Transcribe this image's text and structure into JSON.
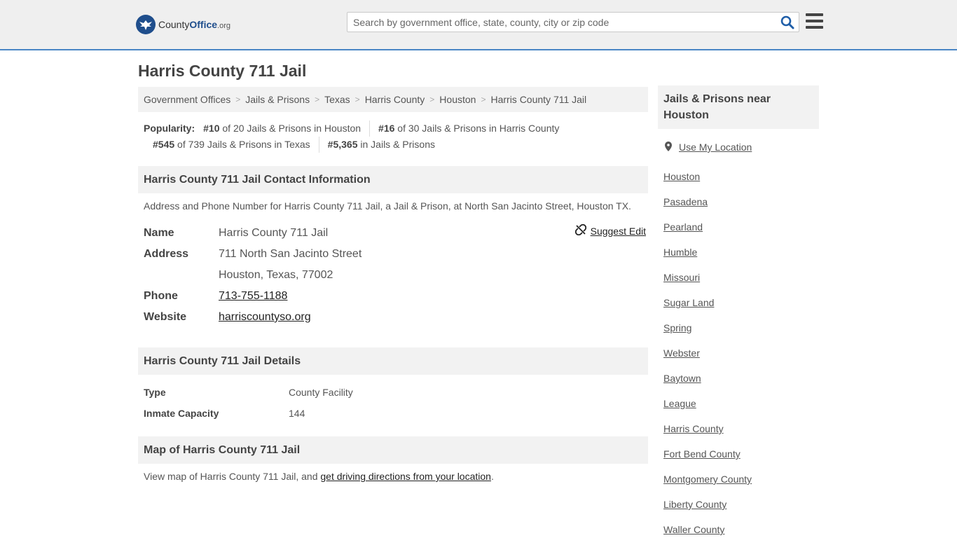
{
  "header": {
    "logo_text_county": "County",
    "logo_text_office": "Office",
    "logo_text_org": ".org",
    "search_placeholder": "Search by government office, state, county, city or zip code"
  },
  "page_title": "Harris County 711 Jail",
  "breadcrumb": [
    "Government Offices",
    "Jails & Prisons",
    "Texas",
    "Harris County",
    "Houston",
    "Harris County 711 Jail"
  ],
  "popularity": {
    "label": "Popularity:",
    "items": [
      {
        "rank": "#10",
        "text": "of 20 Jails & Prisons in Houston"
      },
      {
        "rank": "#16",
        "text": "of 30 Jails & Prisons in Harris County"
      },
      {
        "rank": "#545",
        "text": "of 739 Jails & Prisons in Texas"
      },
      {
        "rank": "#5,365",
        "text": "in Jails & Prisons"
      }
    ]
  },
  "contact": {
    "heading": "Harris County 711 Jail Contact Information",
    "description": "Address and Phone Number for Harris County 711 Jail, a Jail & Prison, at North San Jacinto Street, Houston TX.",
    "name_label": "Name",
    "name_value": "Harris County 711 Jail",
    "address_label": "Address",
    "address_line1": "711 North San Jacinto Street",
    "address_line2": "Houston, Texas, 77002",
    "phone_label": "Phone",
    "phone_value": "713-755-1188",
    "website_label": "Website",
    "website_value": "harriscountyso.org",
    "suggest_edit": "Suggest Edit"
  },
  "details": {
    "heading": "Harris County 711 Jail Details",
    "type_label": "Type",
    "type_value": "County Facility",
    "capacity_label": "Inmate Capacity",
    "capacity_value": "144"
  },
  "map": {
    "heading": "Map of Harris County 711 Jail",
    "desc_prefix": "View map of Harris County 711 Jail, and ",
    "desc_link": "get driving directions from your location",
    "desc_suffix": "."
  },
  "sidebar": {
    "heading": "Jails & Prisons near Houston",
    "use_location": "Use My Location",
    "items": [
      "Houston",
      "Pasadena",
      "Pearland",
      "Humble",
      "Missouri",
      "Sugar Land",
      "Spring",
      "Webster",
      "Baytown",
      "League",
      "Harris County",
      "Fort Bend County",
      "Montgomery County",
      "Liberty County",
      "Waller County"
    ]
  }
}
